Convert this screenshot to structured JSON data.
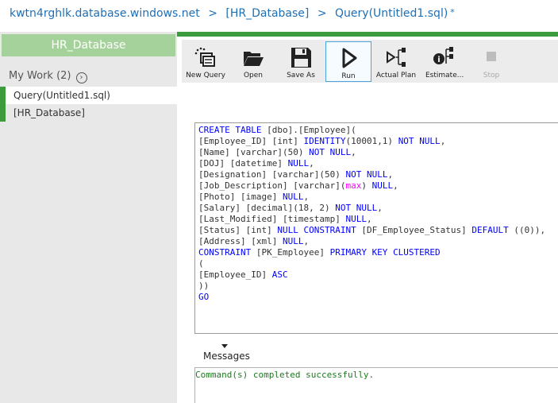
{
  "breadcrumb": {
    "server": "kwtn4rghlk.database.windows.net",
    "sep1": ">",
    "database": "[HR_Database]",
    "sep2": ">",
    "query": "Query(Untitled1.sql)",
    "dirty_marker": "*"
  },
  "sidebar": {
    "db_tab": "HR_Database",
    "my_work_label": "My Work (2)",
    "items": [
      {
        "label": "Query(Untitled1.sql)"
      },
      {
        "label": "[HR_Database]"
      }
    ]
  },
  "toolbar": {
    "buttons": [
      {
        "label": "New Query",
        "icon": "new-query-icon"
      },
      {
        "label": "Open",
        "icon": "folder-open-icon"
      },
      {
        "label": "Save As",
        "icon": "floppy-disk-icon"
      },
      {
        "label": "Run",
        "icon": "play-icon"
      },
      {
        "label": "Actual Plan",
        "icon": "plan-tree-icon"
      },
      {
        "label": "Estimate...",
        "icon": "estimate-plan-icon"
      },
      {
        "label": "Stop",
        "icon": "stop-icon"
      }
    ]
  },
  "editor": {
    "lines": [
      "CREATE TABLE [dbo].[Employee](",
      "[Employee_ID] [int] IDENTITY(10001,1) NOT NULL,",
      "[Name] [varchar](50) NOT NULL,",
      "[DOJ] [datetime] NULL,",
      "[Designation] [varchar](50) NOT NULL,",
      "[Job_Description] [varchar](max) NULL,",
      "[Photo] [image] NULL,",
      "[Salary] [decimal](18, 2) NOT NULL,",
      "[Last_Modified] [timestamp] NULL,",
      "[Status] [int] NULL CONSTRAINT [DF_Employee_Status] DEFAULT ((0)),",
      "[Address] [xml] NULL,",
      "CONSTRAINT [PK_Employee] PRIMARY KEY CLUSTERED",
      "(",
      "[Employee_ID] ASC",
      "))",
      "GO"
    ]
  },
  "messages": {
    "tab_label": "Messages",
    "text": "Command(s) completed successfully."
  },
  "colors": {
    "accent_green": "#3c9b3c",
    "db_tab_green": "#a4d29a",
    "link_blue": "#1f6fb5",
    "sql_keyword": "#0000ff",
    "sql_function": "#ff00ff",
    "success_text": "#1d7a1d"
  }
}
